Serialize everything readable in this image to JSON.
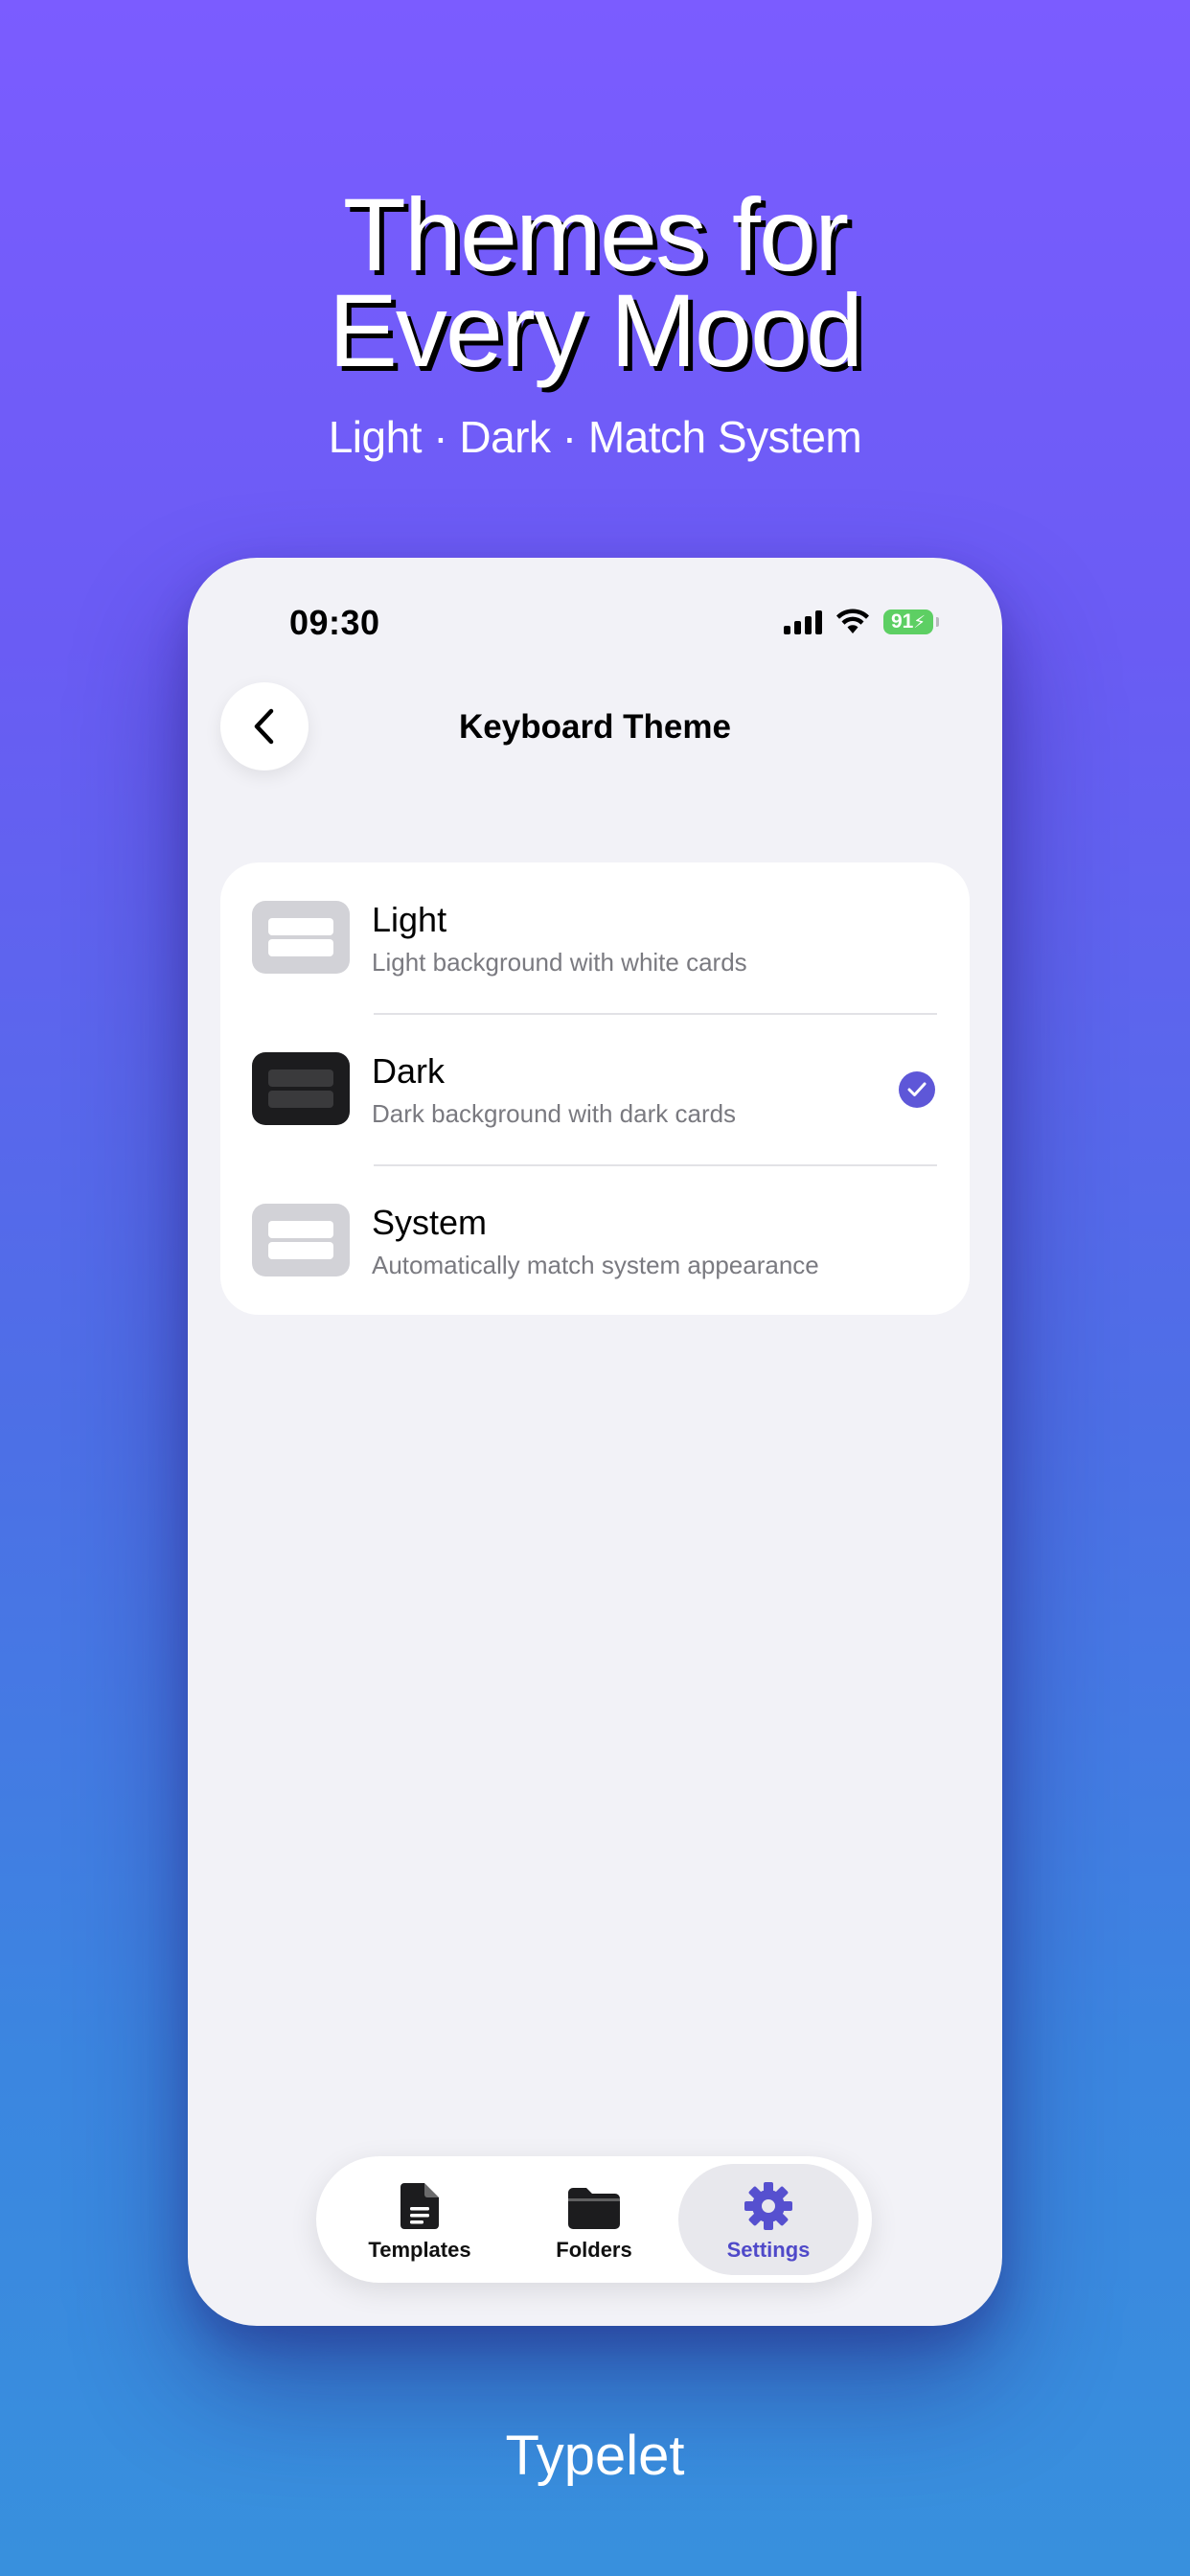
{
  "hero": {
    "title_line1": "Themes for",
    "title_line2": "Every Mood",
    "subtitle": "Light · Dark · Match System"
  },
  "brand": "Typelet",
  "status_bar": {
    "time": "09:30",
    "battery": "91"
  },
  "nav": {
    "title": "Keyboard Theme"
  },
  "themes": [
    {
      "title": "Light",
      "description": "Light background with white cards",
      "selected": false
    },
    {
      "title": "Dark",
      "description": "Dark background with dark cards",
      "selected": true
    },
    {
      "title": "System",
      "description": "Automatically match system appearance",
      "selected": false
    }
  ],
  "tab_bar": {
    "items": [
      {
        "label": "Templates",
        "icon": "document-icon",
        "active": false
      },
      {
        "label": "Folders",
        "icon": "folder-icon",
        "active": false
      },
      {
        "label": "Settings",
        "icon": "gear-icon",
        "active": true
      }
    ]
  },
  "colors": {
    "accent": "#5e57d8",
    "active_tab_text": "#4f49c9",
    "battery": "#5dcf63",
    "gradient_top": "#7b5cff",
    "gradient_bottom": "#3890dd"
  }
}
